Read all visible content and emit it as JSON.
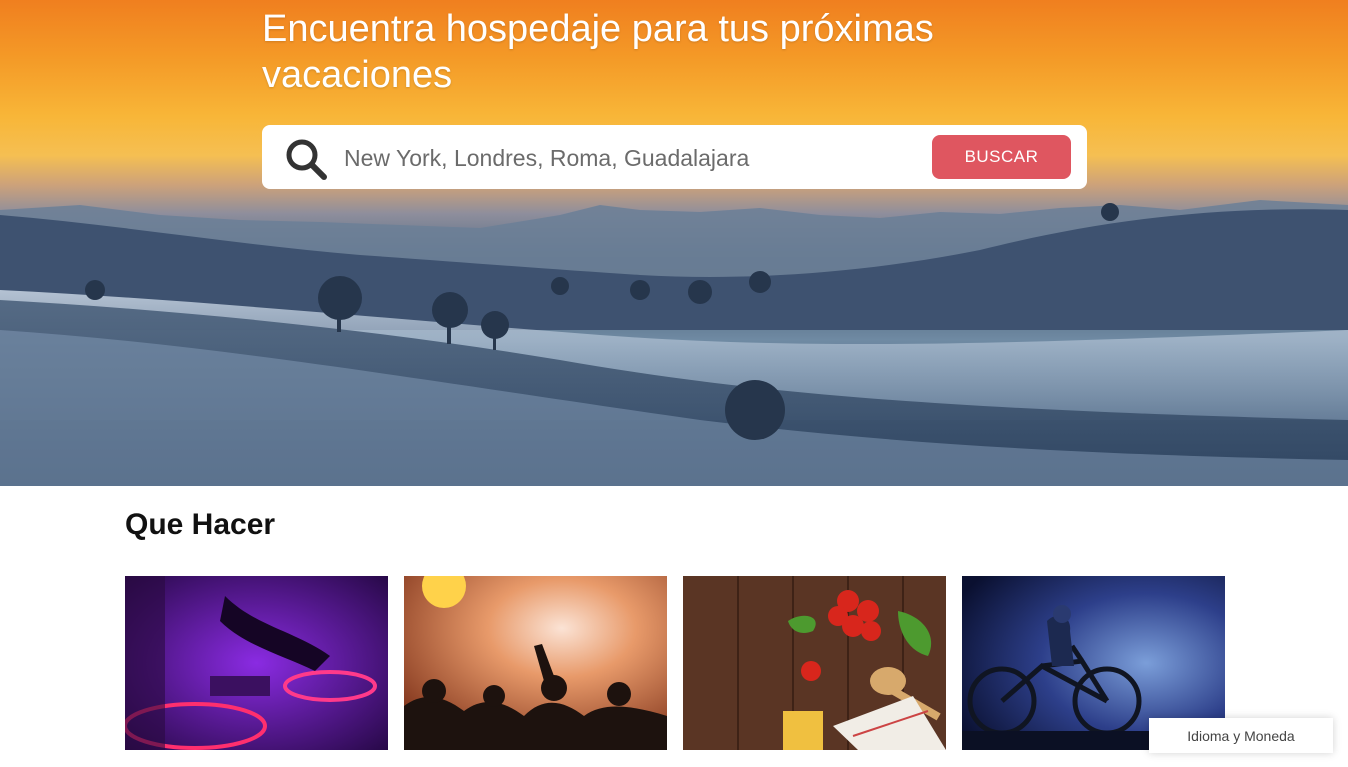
{
  "hero": {
    "title": "Encuentra hospedaje para tus próximas vacaciones"
  },
  "search": {
    "icon": "search-icon",
    "placeholder": "New York, Londres, Roma, Guadalajara",
    "button_label": "BUSCAR"
  },
  "things_to_do": {
    "title": "Que Hacer",
    "cards": [
      {
        "icon": "dj-turntable-image"
      },
      {
        "icon": "concert-crowd-image"
      },
      {
        "icon": "food-ingredients-image"
      },
      {
        "icon": "cyclist-night-image"
      }
    ]
  },
  "footer": {
    "language_currency_label": "Idioma y Moneda"
  },
  "colors": {
    "accent": "#df5660",
    "text_dark": "#111111"
  }
}
